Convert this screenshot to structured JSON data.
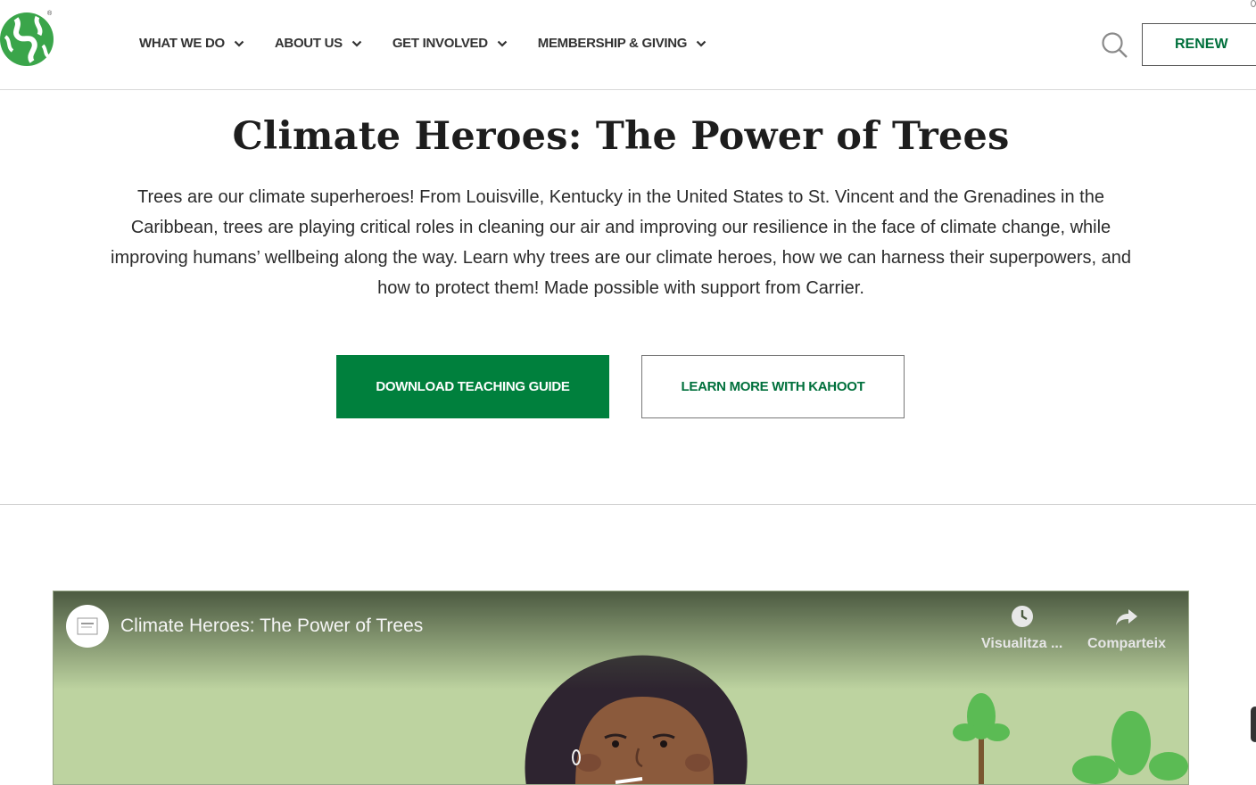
{
  "header": {
    "logo_icon": "globe-leaf-logo",
    "registered_mark": "®",
    "nav": [
      {
        "label": "WHAT WE DO"
      },
      {
        "label": "ABOUT US"
      },
      {
        "label": "GET INVOLVED"
      },
      {
        "label": "MEMBERSHIP & GIVING"
      }
    ],
    "search_icon": "search-icon",
    "renew_label": "RENEW"
  },
  "hero": {
    "title": "Climate Heroes: The Power of Trees",
    "description": "Trees are our climate superheroes! From Louisville, Kentucky in the United States to St. Vincent and the Grenadines in the Caribbean, trees are playing critical roles in cleaning our air and improving our resilience in the face of climate change, while improving humans’ wellbeing along the way. Learn why trees are our climate heroes, how we can harness their superpowers, and how to protect them! Made possible with support from Carrier.",
    "primary_button": "DOWNLOAD TEACHING GUIDE",
    "secondary_button": "LEARN MORE WITH KAHOOT"
  },
  "video": {
    "title": "Climate Heroes: The Power of Trees",
    "watch_later_label": "Visualitza ...",
    "share_label": "Comparteix",
    "channel_icon": "channel-avatar",
    "colors": {
      "accent": "#00803d",
      "video_bg": "#bdd3a0"
    }
  }
}
